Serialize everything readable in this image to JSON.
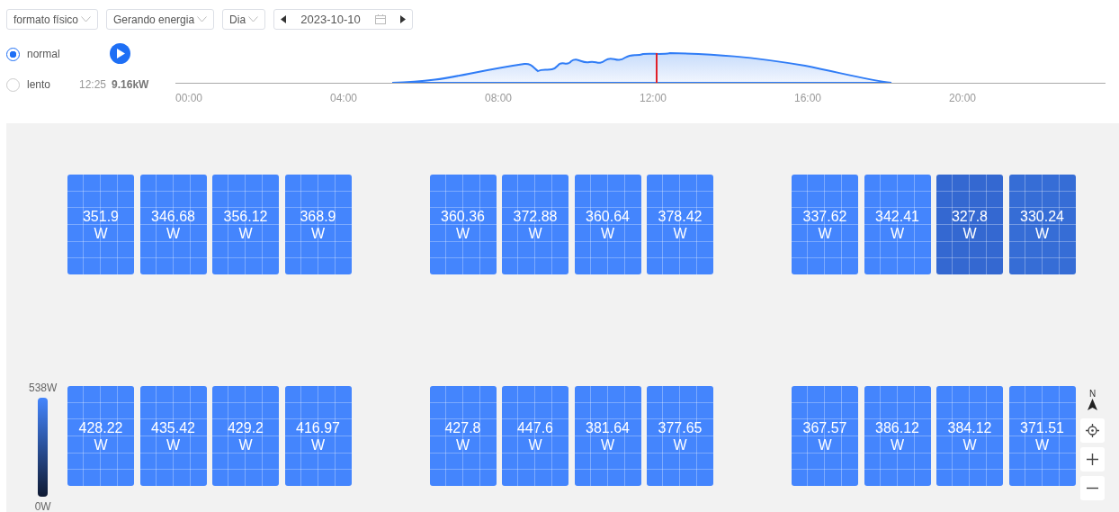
{
  "toolbar": {
    "selects": [
      {
        "value": "formato físico"
      },
      {
        "value": "Gerando energia"
      },
      {
        "value": "Dia"
      }
    ],
    "date": "2023-10-10"
  },
  "playback": {
    "speeds": [
      {
        "label": "normal",
        "selected": true
      },
      {
        "label": "lento",
        "selected": false
      }
    ],
    "time": "12:25",
    "power": "9.16kW"
  },
  "timeline": {
    "ticks": [
      "00:00",
      "04:00",
      "08:00",
      "12:00",
      "16:00",
      "20:00"
    ]
  },
  "legend": {
    "max": "538W",
    "min": "0W"
  },
  "compass": "N",
  "panel_rows": [
    [
      [
        {
          "value": "351.9",
          "unit": "W",
          "color": "#4485fd"
        },
        {
          "value": "346.68",
          "unit": "W",
          "color": "#4485fd"
        },
        {
          "value": "356.12",
          "unit": "W",
          "color": "#4485fd"
        },
        {
          "value": "368.9",
          "unit": "W",
          "color": "#4485fd"
        }
      ],
      [
        {
          "value": "360.36",
          "unit": "W",
          "color": "#4485fd"
        },
        {
          "value": "372.88",
          "unit": "W",
          "color": "#4485fd"
        },
        {
          "value": "360.64",
          "unit": "W",
          "color": "#4485fd"
        },
        {
          "value": "378.42",
          "unit": "W",
          "color": "#4485fd"
        }
      ],
      [
        {
          "value": "337.62",
          "unit": "W",
          "color": "#4485fd"
        },
        {
          "value": "342.41",
          "unit": "W",
          "color": "#4485fd"
        },
        {
          "value": "327.8",
          "unit": "W",
          "color": "#3468d1"
        },
        {
          "value": "330.24",
          "unit": "W",
          "color": "#366dd6"
        }
      ]
    ],
    [
      [
        {
          "value": "428.22",
          "unit": "W",
          "color": "#4485fd"
        },
        {
          "value": "435.42",
          "unit": "W",
          "color": "#4485fd"
        },
        {
          "value": "429.2",
          "unit": "W",
          "color": "#4485fd"
        },
        {
          "value": "416.97",
          "unit": "W",
          "color": "#4485fd"
        }
      ],
      [
        {
          "value": "427.8",
          "unit": "W",
          "color": "#4485fd"
        },
        {
          "value": "447.6",
          "unit": "W",
          "color": "#4485fd"
        },
        {
          "value": "381.64",
          "unit": "W",
          "color": "#4485fd"
        },
        {
          "value": "377.65",
          "unit": "W",
          "color": "#4485fd"
        }
      ],
      [
        {
          "value": "367.57",
          "unit": "W",
          "color": "#4485fd"
        },
        {
          "value": "386.12",
          "unit": "W",
          "color": "#4485fd"
        },
        {
          "value": "384.12",
          "unit": "W",
          "color": "#4485fd"
        },
        {
          "value": "371.51",
          "unit": "W",
          "color": "#4485fd"
        }
      ]
    ]
  ]
}
